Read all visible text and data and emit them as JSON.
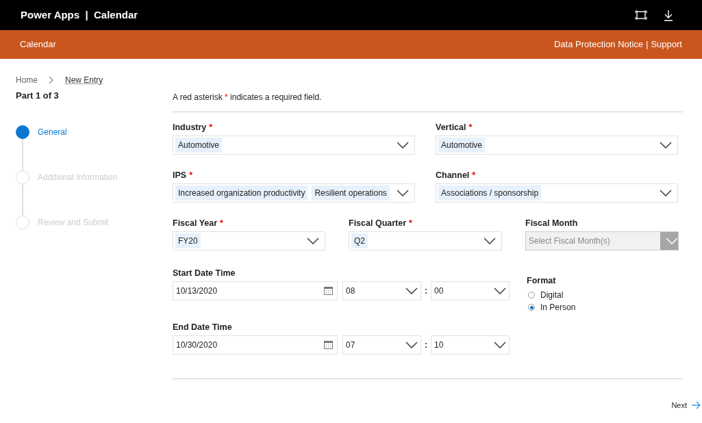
{
  "app_bar": {
    "title": "Power Apps  |  Calendar"
  },
  "header": {
    "title": "Calendar",
    "links": [
      {
        "label": "Data Protection Notice"
      },
      {
        "label": "Support"
      }
    ],
    "separator": "|"
  },
  "breadcrumb": [
    {
      "label": "Home",
      "current": false
    },
    {
      "label": "New Entry",
      "current": true
    }
  ],
  "steps": {
    "heading": "Part 1 of 3",
    "items": [
      {
        "label": "General",
        "selected": true
      },
      {
        "label": "Additional Information",
        "selected": false
      },
      {
        "label": "Review and Submit",
        "selected": false
      }
    ]
  },
  "required_note": {
    "before": "A red asterisk",
    "mark": "*",
    "after": "indicates a required field."
  },
  "rows": [
    [
      {
        "label": "Industry",
        "required": true,
        "disabled": false,
        "tags": [
          "Automotive"
        ]
      },
      {
        "label": "Vertical",
        "required": true,
        "disabled": false,
        "tags": [
          "Automotive"
        ]
      }
    ],
    [
      {
        "label": "IPS",
        "required": true,
        "disabled": false,
        "tags": [
          "Increased organization productivity",
          "Resilient operations"
        ]
      },
      {
        "label": "Channel",
        "required": true,
        "disabled": false,
        "tags": [
          "Associations / sponsorship"
        ]
      }
    ],
    [
      {
        "label": "Fiscal Year",
        "required": true,
        "disabled": false,
        "tags": [
          "FY20"
        ]
      },
      {
        "label": "Fiscal Quarter",
        "required": true,
        "disabled": false,
        "tags": [
          "Q2"
        ]
      },
      {
        "label": "Fiscal Month",
        "required": false,
        "disabled": true,
        "placeholder": "Select Fiscal Month(s)"
      }
    ]
  ],
  "datetimes": [
    {
      "label": "Start Date Time",
      "date": "10/13/2020",
      "hour": "08",
      "separator": ":",
      "minute": "00"
    },
    {
      "label": "End Date Time",
      "date": "10/30/2020",
      "hour": "07",
      "separator": ":",
      "minute": "10"
    }
  ],
  "format": {
    "label": "Format",
    "options": [
      {
        "label": "Digital",
        "selected": false
      },
      {
        "label": "In Person",
        "selected": true
      }
    ]
  },
  "next_button": {
    "label": "Next"
  }
}
